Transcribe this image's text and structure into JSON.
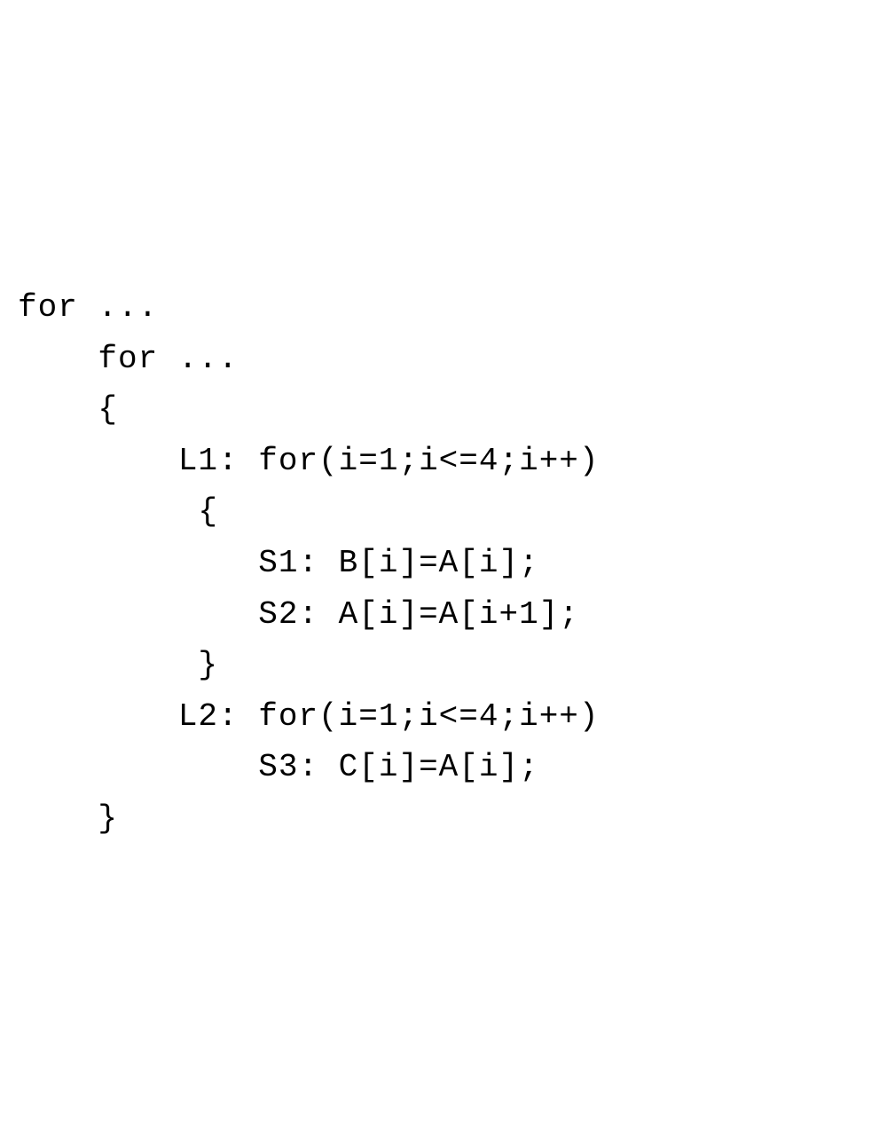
{
  "code": {
    "line1": "for ...",
    "line2": "    for ...",
    "line3": "    {",
    "line4": "        L1: for(i=1;i<=4;i++)",
    "line5": "         {",
    "line6": "            S1: B[i]=A[i];",
    "line7": "            S2: A[i]=A[i+1];",
    "line8": "         }",
    "line9": "        L2: for(i=1;i<=4;i++)",
    "line10": "            S3: C[i]=A[i];",
    "line11": "    }"
  }
}
